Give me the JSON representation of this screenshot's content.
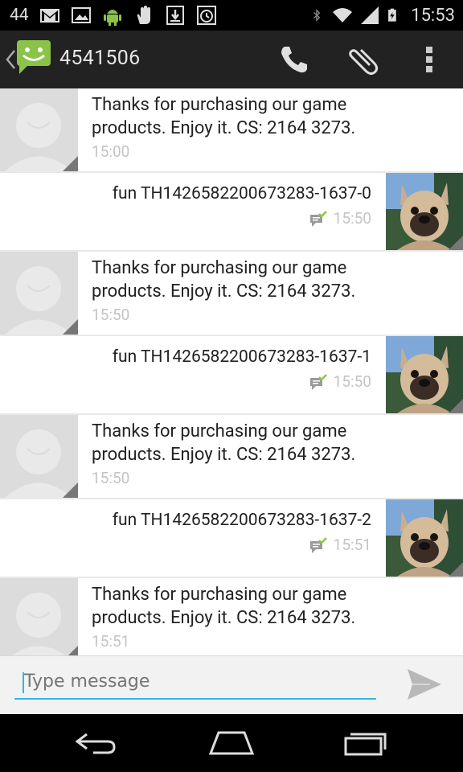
{
  "status_bar": {
    "notification_count": "44",
    "left_icons": [
      "gmail-icon",
      "gallery-icon",
      "android-icon",
      "hand-icon",
      "download-icon",
      "alarm-icon"
    ],
    "right_icons": [
      "bluetooth-icon",
      "wifi-icon",
      "signal-icon",
      "battery-icon"
    ],
    "time": "15:53"
  },
  "action_bar": {
    "title": "4541506",
    "actions": [
      "phone-icon",
      "attach-icon",
      "overflow-menu-icon"
    ]
  },
  "messages": [
    {
      "type": "received",
      "text_line1": "Thanks for purchasing our game",
      "text_line2": "products. Enjoy it. CS: 2164 3273.",
      "time": "15:00"
    },
    {
      "type": "sent",
      "text": "fun TH1426582200673283-1637-0",
      "time": "15:50"
    },
    {
      "type": "received",
      "text_line1": "Thanks for purchasing our game",
      "text_line2": "products. Enjoy it. CS: 2164 3273.",
      "time": "15:50"
    },
    {
      "type": "sent",
      "text": "fun TH1426582200673283-1637-1",
      "time": "15:50"
    },
    {
      "type": "received",
      "text_line1": "Thanks for purchasing our game",
      "text_line2": "products. Enjoy it. CS: 2164 3273.",
      "time": "15:50"
    },
    {
      "type": "sent",
      "text": "fun TH1426582200673283-1637-2",
      "time": "15:51"
    },
    {
      "type": "received",
      "text_line1": "Thanks for purchasing our game",
      "text_line2": "products. Enjoy it. CS: 2164 3273.",
      "time": "15:51"
    }
  ],
  "composer": {
    "placeholder": "Type message"
  },
  "colors": {
    "accent": "#33b5e5",
    "android_green": "#8bc34a",
    "delivered_check": "#8dc63f"
  }
}
